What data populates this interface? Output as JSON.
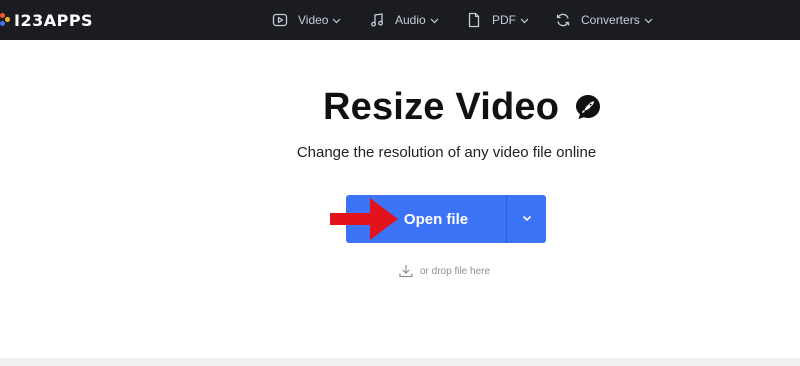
{
  "header": {
    "logo_text": "I23APPS",
    "logo_colors": [
      "#f15a29",
      "#3d73f7",
      "#f7b32b"
    ],
    "nav": [
      {
        "label": "Video",
        "icon": "video-icon"
      },
      {
        "label": "Audio",
        "icon": "music-note-icon"
      },
      {
        "label": "PDF",
        "icon": "document-icon"
      },
      {
        "label": "Converters",
        "icon": "convert-icon"
      }
    ]
  },
  "main": {
    "title": "Resize Video",
    "title_badge_icon": "rocket-icon",
    "subtitle": "Change the resolution of any video file online",
    "open_button_label": "Open file",
    "dropdown_icon": "chevron-down-icon",
    "drop_hint": "or drop file here",
    "drop_icon": "download-icon"
  },
  "annotation": {
    "arrow_color": "#e3131b"
  },
  "colors": {
    "header_bg": "#1a1c21",
    "accent": "#3d73f7"
  }
}
